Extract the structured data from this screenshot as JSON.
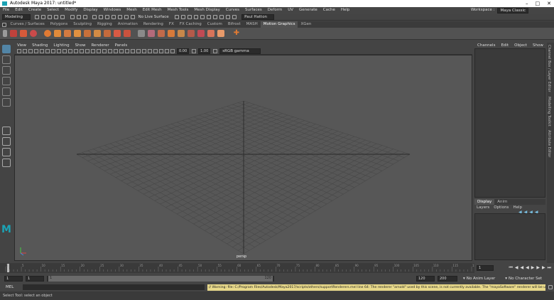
{
  "window": {
    "title": "Autodesk Maya 2017: untitled*"
  },
  "menubar": {
    "items": [
      "File",
      "Edit",
      "Create",
      "Select",
      "Modify",
      "Display",
      "Windows",
      "Mesh",
      "Edit Mesh",
      "Mesh Tools",
      "Mesh Display",
      "Curves",
      "Surfaces",
      "Deform",
      "UV",
      "Generate",
      "Cache",
      "Help"
    ],
    "workspace_label": "Workspace :",
    "workspace_value": "Maya Classic"
  },
  "statusline": {
    "mode": "Modeling",
    "no_live_surface": "No Live Surface",
    "user": "Paul Hatton"
  },
  "shelf": {
    "tabs": [
      "Curves / Surfaces",
      "Polygons",
      "Sculpting",
      "Rigging",
      "Animation",
      "Rendering",
      "FX",
      "FX Caching",
      "Custom",
      "Bifrost",
      "MASH",
      "Motion Graphics",
      "XGen"
    ],
    "active_tab": "Motion Graphics"
  },
  "viewport": {
    "menu": [
      "View",
      "Shading",
      "Lighting",
      "Show",
      "Renderer",
      "Panels"
    ],
    "toolbar": {
      "value1": "0.00",
      "value2": "1.00",
      "colorspace": "sRGB gamma"
    },
    "camera": "persp"
  },
  "channelbox": {
    "menu": [
      "Channels",
      "Edit",
      "Object",
      "Show"
    ]
  },
  "side_tabs": [
    "Channel Box / Layer Editor",
    "Modelling Toolkit",
    "Attribute Editor"
  ],
  "layer_editor": {
    "tabs": [
      "Display",
      "Anim"
    ],
    "menu": [
      "Layers",
      "Options",
      "Help"
    ]
  },
  "timeline": {
    "ticks": [
      "1",
      "5",
      "10",
      "15",
      "20",
      "25",
      "30",
      "35",
      "40",
      "45",
      "50",
      "55",
      "60",
      "65",
      "70",
      "75",
      "80",
      "85",
      "90",
      "95",
      "100",
      "105",
      "110",
      "115",
      "120"
    ],
    "current_frame": "1"
  },
  "range": {
    "start": "1",
    "start_inner": "1",
    "range_field": "1",
    "end_inner": "120",
    "end_slider": "120",
    "end": "120",
    "max_end": "200",
    "anim_layer": "No Anim Layer",
    "char_set": "No Character Set"
  },
  "command": {
    "language": "MEL",
    "message": "// Warning: file: C:/Program Files/Autodesk/Maya2017/scripts/others/supportRenderers.mel line 64: The renderer \"arnold\" used by this scene, is not currently available. The \"mayaSoftware\" renderer will be used instead."
  },
  "helpline": {
    "text": "Select Tool: select an object"
  },
  "colors": {
    "accent": "#5285a6",
    "warning_bg": "#e8d98a",
    "viewport_bg": "#575757"
  }
}
